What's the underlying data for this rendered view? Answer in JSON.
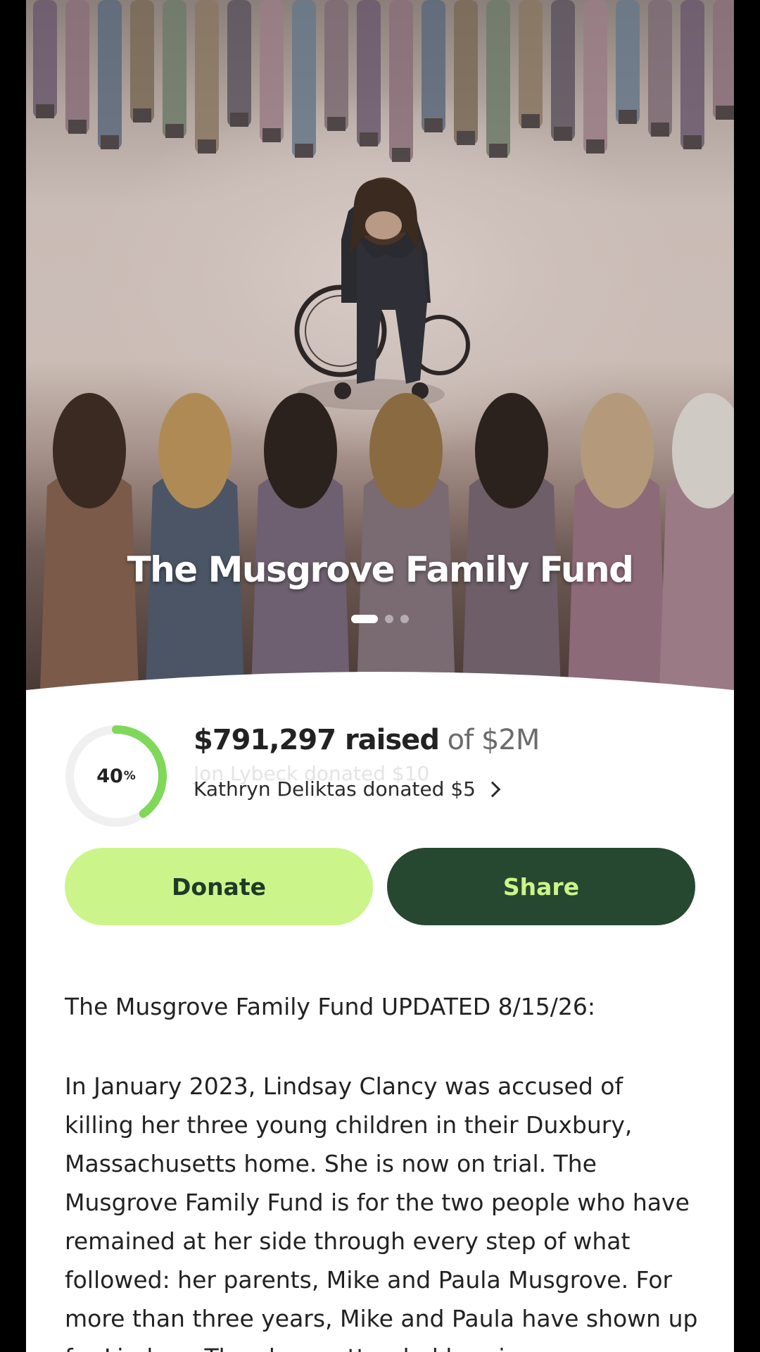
{
  "hero": {
    "title": "The Musgrove Family Fund",
    "image_description_icon": "illustration-image",
    "carousel_pages": 3,
    "carousel_active": 1
  },
  "progress": {
    "percent": 40,
    "percent_label": "40",
    "percent_sign": "%",
    "ring_color": "#7fd85a",
    "raised_amount": "$791,297 raised",
    "goal_text": "of $2M",
    "previous_donor_text": "Jon Lybeck donated $10",
    "recent_donor_text": "Kathryn Deliktas donated $5"
  },
  "actions": {
    "donate_label": "Donate",
    "share_label": "Share",
    "donate_color": "#cbf58a",
    "share_color": "#274830"
  },
  "story": {
    "heading": "The Musgrove Family Fund UPDATED 8/15/26:",
    "body": "In January 2023, Lindsay Clancy was accused of killing her three young children in their Duxbury, Massachusetts home. She is now on trial. The Musgrove Family Fund is for the two people who have remained at her side through every step of what followed: her parents, Mike and Paula Musgrove. For more than three years, Mike and Paula have shown up for Lindsay. They have attended hearings"
  }
}
